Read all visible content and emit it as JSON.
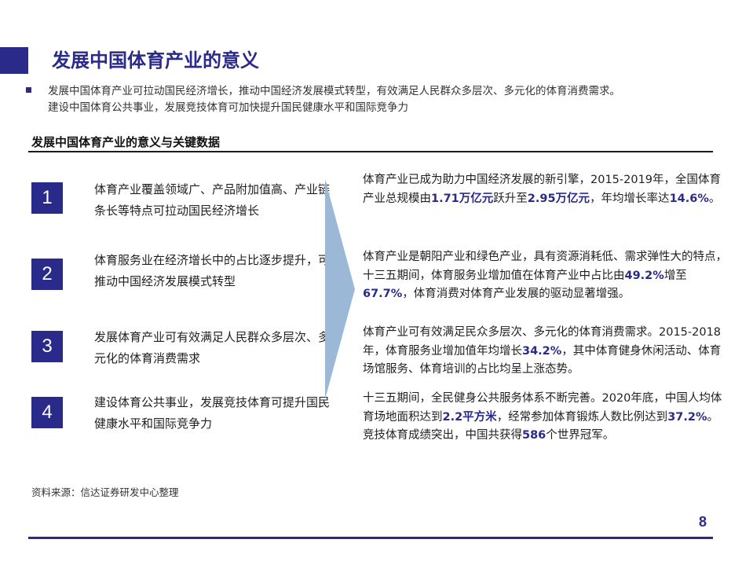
{
  "header": {
    "title": "发展中国体育产业的意义"
  },
  "intro": {
    "line1": "发展中国体育产业可拉动国民经济增长，推动中国经济发展模式转型，有效满足人民群众多层次、多元化的体育消费需求。",
    "line2": "建设中国体育公共事业，发展竞技体育可加快提升国民健康水平和国际竞争力"
  },
  "section": {
    "title": "发展中国体育产业的意义与关键数据"
  },
  "points": [
    {
      "num": "1",
      "text": "体育产业覆盖领域广、产品附加值高、产业链条长等特点可拉动国民经济增长"
    },
    {
      "num": "2",
      "text": "体育服务业在经济增长中的占比逐步提升，可推动中国经济发展模式转型"
    },
    {
      "num": "3",
      "text": "发展体育产业可有效满足人民群众多层次、多元化的体育消费需求"
    },
    {
      "num": "4",
      "text": "建设体育公共事业，发展竞技体育可提升国民健康水平和国际竞争力"
    }
  ],
  "details": {
    "d1": {
      "a": "体育产业已成为助力中国经济发展的新引擎，2015-2019年，全国体育产业总规模由",
      "h1": "1.71万亿元",
      "b": "跃升至",
      "h2": "2.95万亿元",
      "c": "，年均增长率达",
      "h3": "14.6%",
      "d": "。"
    },
    "d2": {
      "a": "体育产业是朝阳产业和绿色产业，具有资源消耗低、需求弹性大的特点，十三五期间，体育服务业增加值在体育产业中占比由",
      "h1": "49.2%",
      "b": "增至",
      "h2": "67.7%",
      "c": "，体育消费对体育产业发展的驱动显著增强。"
    },
    "d3": {
      "a": "体育产业可有效满足民众多层次、多元化的体育消费需求。2015-2018年，体育服务业增加值年均增长",
      "h1": "34.2%",
      "b": "，其中体育健身休闲活动、体育场馆服务、体育培训的占比均呈上涨态势。"
    },
    "d4": {
      "a": "十三五期间，全民健身公共服务体系不断完善。2020年底，中国人均体育场地面积达到",
      "h1": "2.2平方米",
      "b": "，经常参加体育锻炼人数比例达到",
      "h2": "37.2%",
      "c": "。竞技体育成绩突出，中国共获得",
      "h3": "586",
      "d": "个世界冠军。"
    }
  },
  "footer": {
    "source": "资料来源：信达证券研发中心整理",
    "page_number": "8"
  },
  "colors": {
    "brand": "#2a2a8a",
    "arrow": "#9bb8d6"
  }
}
